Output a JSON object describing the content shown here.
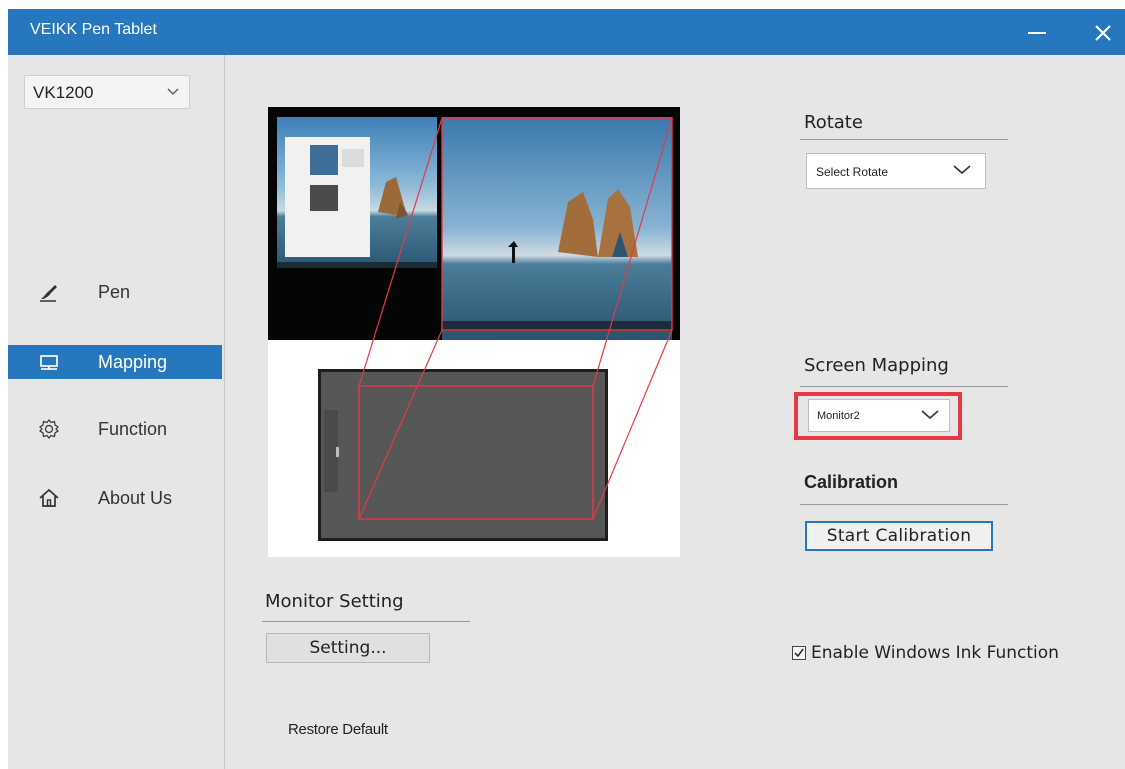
{
  "window": {
    "title": "VEIKK Pen Tablet"
  },
  "colors": {
    "accent": "#2677bd",
    "highlight": "#e33a45",
    "background": "#e6e6e6"
  },
  "sidebar": {
    "model_select": {
      "value": "VK1200"
    },
    "items": [
      {
        "label": "Pen",
        "icon": "pen-icon",
        "active": false
      },
      {
        "label": "Mapping",
        "icon": "monitor-icon",
        "active": true
      },
      {
        "label": "Function",
        "icon": "gear-icon",
        "active": false
      },
      {
        "label": "About Us",
        "icon": "home-icon",
        "active": false
      }
    ]
  },
  "main": {
    "monitor_setting": {
      "title": "Monitor Setting",
      "button_label": "Setting..."
    },
    "restore_default": "Restore Default",
    "rotate": {
      "title": "Rotate",
      "selected": "Select Rotate"
    },
    "screen_mapping": {
      "title": "Screen Mapping",
      "selected": "Monitor2"
    },
    "calibration": {
      "title": "Calibration",
      "button_label": "Start Calibration"
    },
    "windows_ink": {
      "label": "Enable Windows Ink Function",
      "checked": true
    }
  }
}
